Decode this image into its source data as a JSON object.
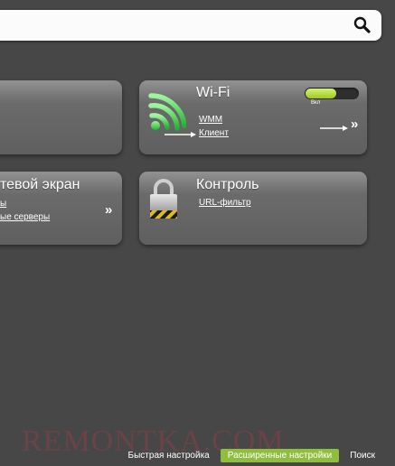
{
  "search": {
    "placeholder": "",
    "value": "",
    "icon": "search-icon"
  },
  "cards": {
    "left_top": {
      "title": "",
      "links": []
    },
    "wifi": {
      "title": "Wi-Fi",
      "icon": "wifi-signal-icon",
      "links": [
        "WMM",
        "Клиент"
      ],
      "toggle": {
        "label": "Вкл",
        "state": "on"
      },
      "more": "»"
    },
    "firewall": {
      "title": "тевой экран",
      "links": [
        "ы",
        "ые серверы"
      ],
      "more": "»"
    },
    "control": {
      "title": "Контроль",
      "icon": "padlock-icon",
      "links": [
        "URL-фильтр"
      ]
    }
  },
  "footer": {
    "items": [
      "Быстрая настройка",
      "Расширенные настройки",
      "Поиск"
    ],
    "active": "Расширенные настройки"
  },
  "watermark": "REMONTKA.COM",
  "colors": {
    "background": "#474747",
    "accent": "#8fbe3e",
    "wifi_green": "#3ec94a"
  }
}
